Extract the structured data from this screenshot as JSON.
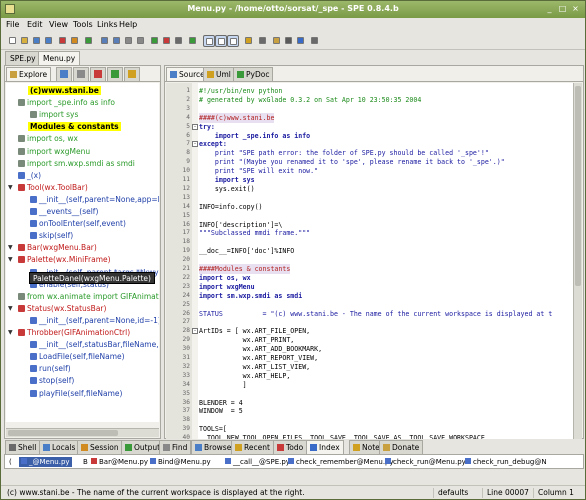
{
  "window": {
    "title": "Menu.py - /home/otto/sorsat/_spe - SPE 0.8.4.b"
  },
  "menu": [
    "File",
    "Edit",
    "View",
    "Tools",
    "Links",
    "Help"
  ],
  "toolbar": {
    "icons": [
      "new-file-icon",
      "open-file-icon",
      "save-icon",
      "save-all-icon",
      "close-icon",
      "undo-icon",
      "redo-icon",
      "browse-icon",
      "browse-source-icon",
      "find-icon",
      "find-next-icon",
      "run-icon",
      "debug-icon",
      "import-icon",
      "refresh-icon",
      "toggle-sidebar-icon",
      "toggle-shell-icon",
      "toggle-layout-icon",
      "color-icon",
      "settings-icon",
      "wxglade-icon",
      "xrced-icon",
      "check-icon",
      "help-icon"
    ]
  },
  "file_tabs": [
    "SPE.py",
    "Menu.py"
  ],
  "left_tabs": {
    "explore": "Explore"
  },
  "tree": [
    {
      "label": "(c)www.stani.be",
      "indent": 0,
      "style": "yellow",
      "icon": "none"
    },
    {
      "label": "import _spe.info as info",
      "indent": 0,
      "style": "green",
      "icon": "module"
    },
    {
      "label": "import sys",
      "indent": 1,
      "style": "green",
      "icon": "module"
    },
    {
      "label": "Modules & constants",
      "indent": 0,
      "style": "yellow",
      "icon": "none"
    },
    {
      "label": "import os, wx",
      "indent": 0,
      "style": "green",
      "icon": "module"
    },
    {
      "label": "import wxgMenu",
      "indent": 0,
      "style": "green",
      "icon": "module"
    },
    {
      "label": "import sm.wxp.smdi as smdi",
      "indent": 0,
      "style": "green",
      "icon": "module"
    },
    {
      "label": "_(x)",
      "indent": 0,
      "style": "blue",
      "icon": "func"
    },
    {
      "label": "Tool(wx.ToolBar)",
      "indent": 0,
      "style": "red",
      "icon": "class",
      "expand": true
    },
    {
      "label": "__init__(self,parent=None,app=N",
      "indent": 1,
      "style": "blue",
      "icon": "func"
    },
    {
      "label": "__events__(self)",
      "indent": 1,
      "style": "blue",
      "icon": "func"
    },
    {
      "label": "onToolEnter(self,event)",
      "indent": 1,
      "style": "blue",
      "icon": "func"
    },
    {
      "label": "skip(self)",
      "indent": 1,
      "style": "blue",
      "icon": "func"
    },
    {
      "label": "Bar(wxgMenu.Bar)",
      "indent": 0,
      "style": "red",
      "icon": "class",
      "expand": true
    },
    {
      "label": "Palette(wx.MiniFrame)",
      "indent": 0,
      "style": "red",
      "icon": "class",
      "expand": true
    },
    {
      "label": "__init__(self, parent,*args,**kwy)",
      "indent": 1,
      "style": "blue",
      "icon": "func"
    },
    {
      "label": "enable(self,status)",
      "indent": 1,
      "style": "blue",
      "icon": "func"
    },
    {
      "label": "from wx.animate import GIFAnimatio",
      "indent": 0,
      "style": "green",
      "icon": "module"
    },
    {
      "label": "Status(wx.StatusBar)",
      "indent": 0,
      "style": "red",
      "icon": "class",
      "expand": true
    },
    {
      "label": "__init__(self,parent=None,id=-1)",
      "indent": 1,
      "style": "blue",
      "icon": "func"
    },
    {
      "label": "Throbber(GIFAnimationCtrl)",
      "indent": 0,
      "style": "red",
      "icon": "class",
      "expand": true
    },
    {
      "label": "__init__(self,statusBar,fileName,p",
      "indent": 1,
      "style": "blue",
      "icon": "func"
    },
    {
      "label": "LoadFile(self,fileName)",
      "indent": 1,
      "style": "blue",
      "icon": "func"
    },
    {
      "label": "run(self)",
      "indent": 1,
      "style": "blue",
      "icon": "func"
    },
    {
      "label": "stop(self)",
      "indent": 1,
      "style": "blue",
      "icon": "func"
    },
    {
      "label": "playFile(self,fileName)",
      "indent": 1,
      "style": "blue",
      "icon": "func"
    }
  ],
  "tooltip": "PaletteDanel(wxgMenu.Palette)",
  "editor_tabs": [
    "Source",
    "Uml",
    "PyDoc"
  ],
  "code": [
    {
      "n": "1",
      "t": "#!/usr/bin/env python",
      "c": "comment"
    },
    {
      "n": "2",
      "t": "# generated by wxGlade 0.3.2 on Sat Apr 10 23:50:35 2004",
      "c": "comment"
    },
    {
      "n": "3",
      "t": "",
      "c": "plain"
    },
    {
      "n": "4",
      "t": "####(c)www.stani.be",
      "c": "hash"
    },
    {
      "n": "5",
      "t": "try:",
      "c": "kw"
    },
    {
      "n": "6",
      "t": "    import _spe.info as info",
      "c": "imp"
    },
    {
      "n": "7",
      "t": "except:",
      "c": "kw"
    },
    {
      "n": "8",
      "t": "    print \"SPE path error: the folder of SPE.py should be called '_spe'!\"",
      "c": "str"
    },
    {
      "n": "9",
      "t": "    print \"(Maybe you renamed it to 'spe', please rename it back to '_spe'.)\"",
      "c": "str"
    },
    {
      "n": "10",
      "t": "    print \"SPE will exit now.\"",
      "c": "str"
    },
    {
      "n": "11",
      "t": "    import sys",
      "c": "imp"
    },
    {
      "n": "12",
      "t": "    sys.exit()",
      "c": "plain"
    },
    {
      "n": "13",
      "t": "",
      "c": "plain"
    },
    {
      "n": "14",
      "t": "INFO=info.copy()",
      "c": "plain"
    },
    {
      "n": "15",
      "t": "",
      "c": "plain"
    },
    {
      "n": "16",
      "t": "INFO['description']=\\",
      "c": "plain"
    },
    {
      "n": "17",
      "t": "\"\"\"Subclassed mmdi frame.\"\"\"",
      "c": "str2"
    },
    {
      "n": "18",
      "t": "",
      "c": "plain"
    },
    {
      "n": "19",
      "t": "__doc__=INFO['doc']%INFO",
      "c": "plain"
    },
    {
      "n": "20",
      "t": "",
      "c": "plain"
    },
    {
      "n": "21",
      "t": "####Modules & constants",
      "c": "hash"
    },
    {
      "n": "22",
      "t": "import os, wx",
      "c": "imp"
    },
    {
      "n": "23",
      "t": "import wxgMenu",
      "c": "imp"
    },
    {
      "n": "24",
      "t": "import sm.wxp.smdi as smdi",
      "c": "imp"
    },
    {
      "n": "25",
      "t": "",
      "c": "plain"
    },
    {
      "n": "26",
      "t": "STATUS          = \"(c) www.stani.be - The name of the current workspace is displayed at t",
      "c": "str"
    },
    {
      "n": "27",
      "t": "",
      "c": "plain"
    },
    {
      "n": "28",
      "t": "ArtIDs = [ wx.ART_FILE_OPEN,",
      "c": "plain"
    },
    {
      "n": "29",
      "t": "           wx.ART_PRINT,",
      "c": "plain"
    },
    {
      "n": "30",
      "t": "           wx.ART_ADD_BOOKMARK,",
      "c": "plain"
    },
    {
      "n": "31",
      "t": "           wx.ART_REPORT_VIEW,",
      "c": "plain"
    },
    {
      "n": "32",
      "t": "           wx.ART_LIST_VIEW,",
      "c": "plain"
    },
    {
      "n": "33",
      "t": "           wx.ART_HELP,",
      "c": "plain"
    },
    {
      "n": "34",
      "t": "           ]",
      "c": "plain"
    },
    {
      "n": "35",
      "t": "",
      "c": "plain"
    },
    {
      "n": "36",
      "t": "BLENDER = 4",
      "c": "num"
    },
    {
      "n": "37",
      "t": "WINDOW  = 5",
      "c": "num"
    },
    {
      "n": "38",
      "t": "",
      "c": "plain"
    },
    {
      "n": "39",
      "t": "TOOLS=[",
      "c": "plain"
    },
    {
      "n": "40",
      "t": "  TOOL_NEW,TOOL_OPEN_FILES, TOOL_SAVE, TOOL_SAVE_AS, TOOL_SAVE_WORKSPACE,",
      "c": "plain"
    }
  ],
  "bottom_tabs": [
    "Shell",
    "Locals",
    "Session",
    "Output",
    "Find",
    "Browser",
    "Recent",
    "Todo",
    "Index",
    "Notes",
    "Donate"
  ],
  "index_items": [
    "(",
    "_@Menu.py",
    "B",
    "Bar@Menu.py",
    "Bind@Menu.py",
    "__call__@SPE.py",
    "check_remember@Menu.py",
    "check_run@Menu.py",
    "check_run_debug@N"
  ],
  "status": {
    "message": "(c) www.stani.be - The name of the current workspace is displayed at the right.",
    "workspace": "defaults",
    "line": "Line 00007",
    "column": "Column 1"
  },
  "colors": {
    "comment": "#1a8a1a",
    "keyword": "#1a1aa0",
    "string": "#1a1aa0",
    "hash": "#b22222",
    "tree_green": "#2a9a2a",
    "tree_blue": "#1f3fa8",
    "tree_red": "#c01818",
    "highlight": "#ffff00"
  }
}
